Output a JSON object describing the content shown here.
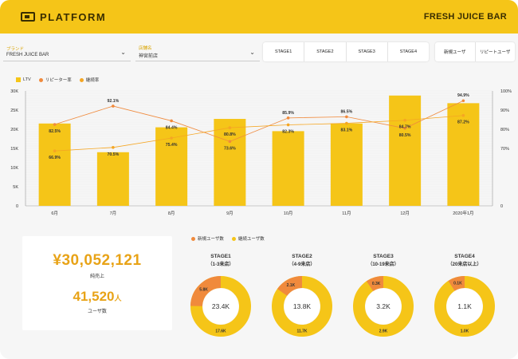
{
  "header": {
    "logo_text": "PLATFORM",
    "store_title": "FRESH JUICE BAR"
  },
  "filters": {
    "brand": {
      "label": "ブランド",
      "value": "FRESH JUICE BAR"
    },
    "store": {
      "label": "店舗名",
      "value": "神宮前店"
    },
    "stages": [
      "STAGE1",
      "STAGE2",
      "STAGE3",
      "STAGE4"
    ],
    "user_types": [
      "新規ユーザ",
      "リピートユーザ"
    ]
  },
  "colors": {
    "accent": "#f5c518",
    "orange": "#f08a3c",
    "brand_text": "#e8a317"
  },
  "chart_data": {
    "type": "bar",
    "categories": [
      "6月",
      "7月",
      "8月",
      "9月",
      "10月",
      "11月",
      "12月",
      "2020年1月"
    ],
    "legend": [
      "LTV",
      "リピーター率",
      "継続率"
    ],
    "bar_series": {
      "name": "LTV",
      "values": [
        21500,
        14000,
        20500,
        22700,
        19500,
        21500,
        28800,
        26800
      ]
    },
    "line_series": [
      {
        "name": "リピーター率",
        "values": [
          82.5,
          92.1,
          84.4,
          73.6,
          85.9,
          86.5,
          80.5,
          94.9
        ],
        "labels": [
          "82.5%",
          "92.1%",
          "84.4%",
          "73.6%",
          "85.9%",
          "86.5%",
          "80.5%",
          "94.9%"
        ]
      },
      {
        "name": "継続率",
        "values": [
          66.9,
          70.5,
          75.4,
          80.8,
          82.3,
          83.1,
          84.7,
          87.2
        ],
        "labels": [
          "66.9%",
          "70.5%",
          "75.4%",
          "80.8%",
          "82.3%",
          "83.1%",
          "84.7%",
          "87.2%"
        ]
      }
    ],
    "y_left": {
      "min": 0,
      "max": 30000,
      "ticks": [
        "0",
        "5K",
        "10K",
        "15K",
        "20K",
        "25K",
        "30K"
      ]
    },
    "y_right": {
      "ticks": [
        "0",
        "70%",
        "80%",
        "90%",
        "100%"
      ]
    }
  },
  "summary": {
    "sales_value": "¥30,052,121",
    "sales_label": "純売上",
    "users_value": "41,520",
    "users_unit": "人",
    "users_label": "ユーザ数"
  },
  "donut_legend": {
    "new": "新規ユーザ数",
    "existing": "継続ユーザ数"
  },
  "stages": [
    {
      "name": "STAGE1",
      "sub": "（1-3来店）",
      "total": "23.4K",
      "new": "5.8K",
      "existing": "17.6K",
      "new_value": 5.8,
      "existing_value": 17.6
    },
    {
      "name": "STAGE2",
      "sub": "（4-9来店）",
      "total": "13.8K",
      "new": "2.1K",
      "existing": "11.7K",
      "new_value": 2.1,
      "existing_value": 11.7
    },
    {
      "name": "STAGE3",
      "sub": "（10-19来店）",
      "total": "3.2K",
      "new": "0.3K",
      "existing": "2.9K",
      "new_value": 0.3,
      "existing_value": 2.9
    },
    {
      "name": "STAGE4",
      "sub": "（20来店以上）",
      "total": "1.1K",
      "new": "0.1K",
      "existing": "1.0K",
      "new_value": 0.1,
      "existing_value": 1.0
    }
  ]
}
